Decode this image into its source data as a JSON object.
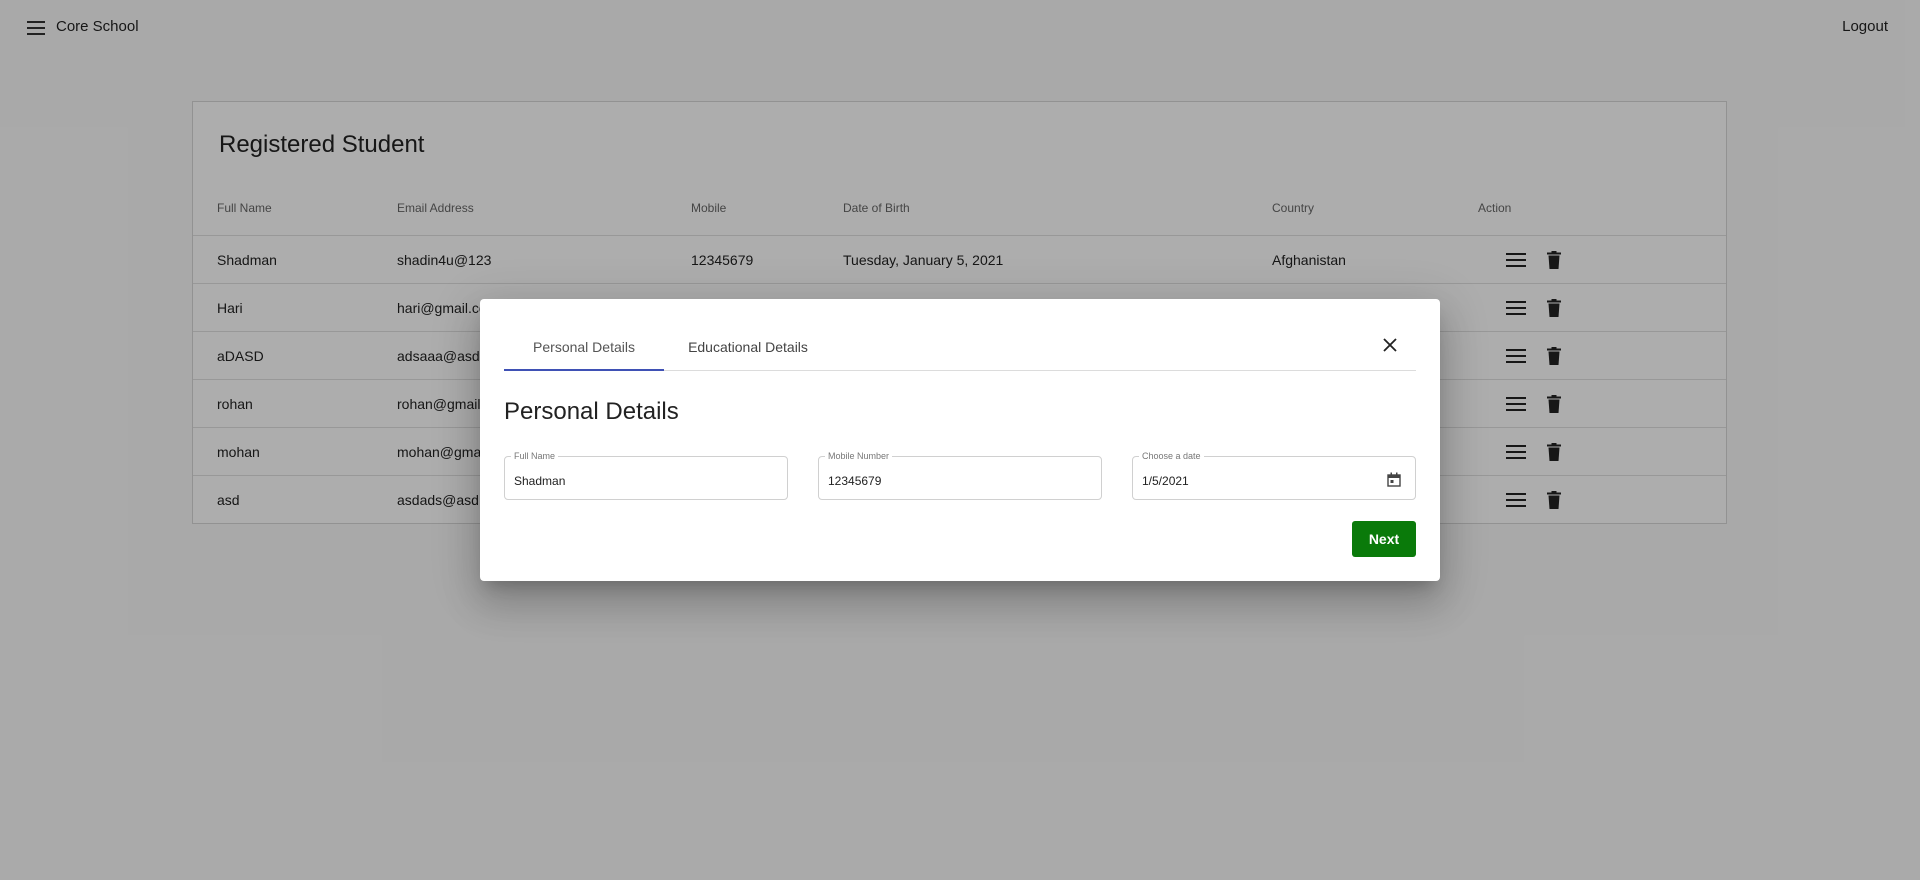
{
  "toolbar": {
    "menu_icon": "menu-icon",
    "title": "Core School",
    "logout_label": "Logout"
  },
  "card": {
    "title": "Registered Student",
    "columns": [
      "Full Name",
      "Email Address",
      "Mobile",
      "Date of Birth",
      "Country",
      "Action"
    ],
    "rows": [
      {
        "name": "Shadman",
        "email": "shadin4u@123",
        "mobile": "12345679",
        "dob": "Tuesday, January 5, 2021",
        "country": "Afghanistan"
      },
      {
        "name": "Hari",
        "email": "hari@gmail.co",
        "mobile": "",
        "dob": "",
        "country": ""
      },
      {
        "name": "aDASD",
        "email": "adsaaa@asd.",
        "mobile": "",
        "dob": "",
        "country": ""
      },
      {
        "name": "rohan",
        "email": "rohan@gmail",
        "mobile": "",
        "dob": "",
        "country": ""
      },
      {
        "name": "mohan",
        "email": "mohan@gma",
        "mobile": "",
        "dob": "",
        "country": ""
      },
      {
        "name": "asd",
        "email": "asdads@asd.",
        "mobile": "",
        "dob": "",
        "country": ""
      }
    ],
    "row_action_icons": [
      "menu-icon",
      "delete-icon"
    ]
  },
  "dialog": {
    "tabs": [
      {
        "label": "Personal Details",
        "active": true
      },
      {
        "label": "Educational Details",
        "active": false
      }
    ],
    "heading": "Personal Details",
    "fields": {
      "full_name": {
        "label": "Full Name",
        "value": "Shadman"
      },
      "mobile": {
        "label": "Mobile Number",
        "value": "12345679"
      },
      "date": {
        "label": "Choose a date",
        "value": "1/5/2021"
      }
    },
    "next_label": "Next",
    "accent_color": "#3f51b5",
    "next_color": "#0a7a0a"
  }
}
